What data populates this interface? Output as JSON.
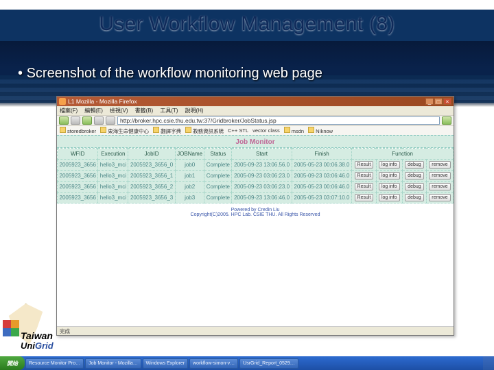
{
  "slide": {
    "title": "User Workflow Management (8)",
    "bullet": "Screenshot of the workflow monitoring web page"
  },
  "browser": {
    "window_title": "L1 Mozilla - Mozilla Firefox",
    "menu": [
      "檔案(F)",
      "編輯(E)",
      "檢視(V)",
      "書籤(B)",
      "工具(T)",
      "說明(H)"
    ],
    "url": "http://broker.hpc.csie.thu.edu.tw:37/Gridbroker/JobStatus.jsp",
    "bookmarks": [
      "storedbroker",
      "東海生命健康中心",
      "翻譯字典",
      "教務資訊系統",
      "C++ STL",
      "vector class",
      "msdn",
      "NIknow"
    ],
    "status": "完成"
  },
  "monitor": {
    "title": "Job Monitor",
    "headers": [
      "WFID",
      "Execution",
      "JobID",
      "JOBName",
      "Status",
      "Start",
      "Finish",
      "Function"
    ],
    "rows": [
      {
        "wfid": "2005923_3656",
        "exec": "hello3_mci",
        "jobid": "2005923_3656_0",
        "jobname": "job0",
        "status": "Complete",
        "start": "2005-09-23 13:06.56.0",
        "finish": "2005-05-23 00:06.38.0"
      },
      {
        "wfid": "2005923_3656",
        "exec": "hello3_mci",
        "jobid": "2005923_3656_1",
        "jobname": "job1",
        "status": "Complete",
        "start": "2005-09-23 03:06:23.0",
        "finish": "2005-09-23 03:06:46.0"
      },
      {
        "wfid": "2005923_3656",
        "exec": "hello3_mci",
        "jobid": "2005923_3656_2",
        "jobname": "job2",
        "status": "Complete",
        "start": "2005-09-23 03:06:23.0",
        "finish": "2005-05-23 00:06:46.0"
      },
      {
        "wfid": "2005923_3656",
        "exec": "hello3_mci",
        "jobid": "2005923_3656_3",
        "jobname": "job3",
        "status": "Complete",
        "start": "2005-09-23 13:06:46.0",
        "finish": "2005-05-23 03:07:10.0"
      }
    ],
    "fn_buttons": [
      "Result",
      "log info",
      "debug",
      "remove"
    ],
    "footer1": "Powered by Credin Liu",
    "footer2": "Copyright(C)2005. HPC Lab. CSIE THU. All Rights Reserved"
  },
  "taskbar": {
    "start": "開始",
    "items": [
      "Resource Monitor Pro…",
      "Job Monitor - Mozilla…",
      "Windows Explorer",
      "workflow-simon-v…",
      "UsrGrid_Report_0529…"
    ]
  },
  "logo": {
    "line1": "Taiwan",
    "line2a": "Uni",
    "line2b": "Grid"
  }
}
